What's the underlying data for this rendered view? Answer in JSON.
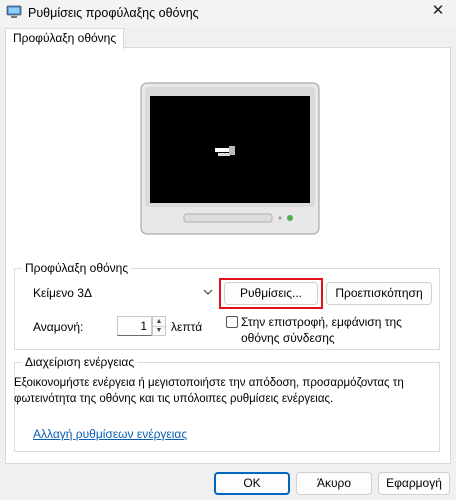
{
  "window": {
    "title": "Ρυθμίσεις προφύλαξης οθόνης",
    "close_glyph": "✕"
  },
  "tabs": [
    {
      "label": "Προφύλαξη οθόνης"
    }
  ],
  "screensaver_group": {
    "legend": "Προφύλαξη οθόνης",
    "selected": "Κείμενο 3Δ",
    "settings_label": "Ρυθμίσεις...",
    "preview_label": "Προεπισκόπηση",
    "wait_label": "Αναμονή:",
    "wait_value": "1",
    "wait_unit": "λεπτά",
    "resume_line1": "Στην επιστροφή, εμφάνιση της",
    "resume_line2": "οθόνης σύνδεσης",
    "resume_checked": false
  },
  "power_group": {
    "legend": "Διαχείριση ενέργειας",
    "description": "Εξοικονομήστε ενέργεια ή μεγιστοποιήστε την απόδοση, προσαρμόζοντας τη φωτεινότητα της οθόνης και τις υπόλοιπες ρυθμίσεις ενέργειας.",
    "link": "Αλλαγή ρυθμίσεων ενέργειας"
  },
  "footer": {
    "ok": "OK",
    "cancel": "Άκυρο",
    "apply": "Εφαρμογή"
  },
  "colors": {
    "highlight": "#e3111b",
    "link": "#0a5fb4",
    "ok_border": "#0067c0"
  }
}
